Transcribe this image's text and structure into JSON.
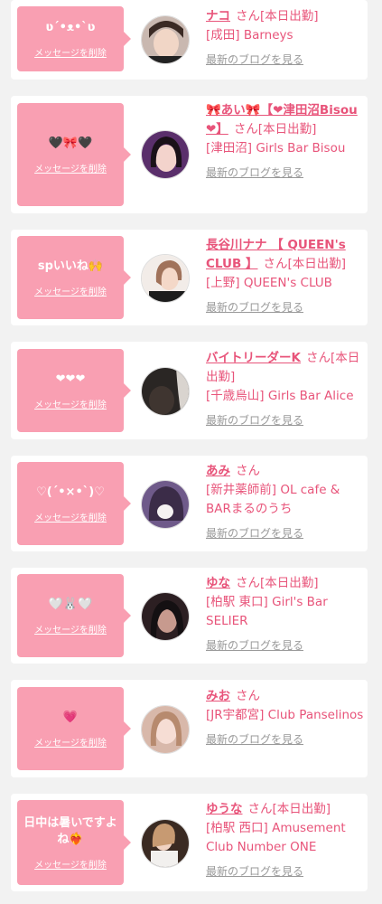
{
  "accent": "#e8547a",
  "bubble_color": "#f99fb2",
  "items": [
    {
      "message": "ʋ´•ᴥ•`ʋ",
      "delete_label": "メッセージを削除",
      "name": "ナコ",
      "suffix": "さん[本日出勤]",
      "shop": "[成田] Barneys",
      "blog_label": "最新のブログを見る"
    },
    {
      "message": "🖤🎀🖤",
      "delete_label": "メッセージを削除",
      "name": "🎀あい🎀【❤津田沼Bisou❤】",
      "suffix": "さん[本日出勤]",
      "shop": "[津田沼] Girls Bar Bisou",
      "blog_label": "最新のブログを見る"
    },
    {
      "message": "spいいね🙌",
      "delete_label": "メッセージを削除",
      "name": "長谷川ナナ 【 QUEEN's CLUB 】",
      "suffix": "さん[本日出勤]",
      "shop": "[上野] QUEEN's CLUB",
      "blog_label": "最新のブログを見る"
    },
    {
      "message": "❤❤❤",
      "delete_label": "メッセージを削除",
      "name": "バイトリーダーK",
      "suffix": "さん[本日出勤]",
      "shop": "[千歳烏山] Girls Bar Alice",
      "blog_label": "最新のブログを見る"
    },
    {
      "message": "♡(ˊ•×•ˋ)♡",
      "delete_label": "メッセージを削除",
      "name": "あみ",
      "suffix": "さん",
      "shop": "[新井薬師前] OL cafe & BARまるのうち",
      "blog_label": "最新のブログを見る"
    },
    {
      "message": "🤍🐰🤍",
      "delete_label": "メッセージを削除",
      "name": "ゆな",
      "suffix": "さん[本日出勤]",
      "shop": "[柏駅 東口] Girl's Bar SELIER",
      "blog_label": "最新のブログを見る"
    },
    {
      "message": "💗",
      "delete_label": "メッセージを削除",
      "name": "みお",
      "suffix": "さん",
      "shop": "[JR宇都宮] Club Panselinos",
      "blog_label": "最新のブログを見る"
    },
    {
      "message": "日中は暑いですよね❤‍🔥",
      "delete_label": "メッセージを削除",
      "name": "ゆうな",
      "suffix": "さん[本日出勤]",
      "shop": "[柏駅 西口] Amusement Club Number ONE",
      "blog_label": "最新のブログを見る"
    }
  ]
}
